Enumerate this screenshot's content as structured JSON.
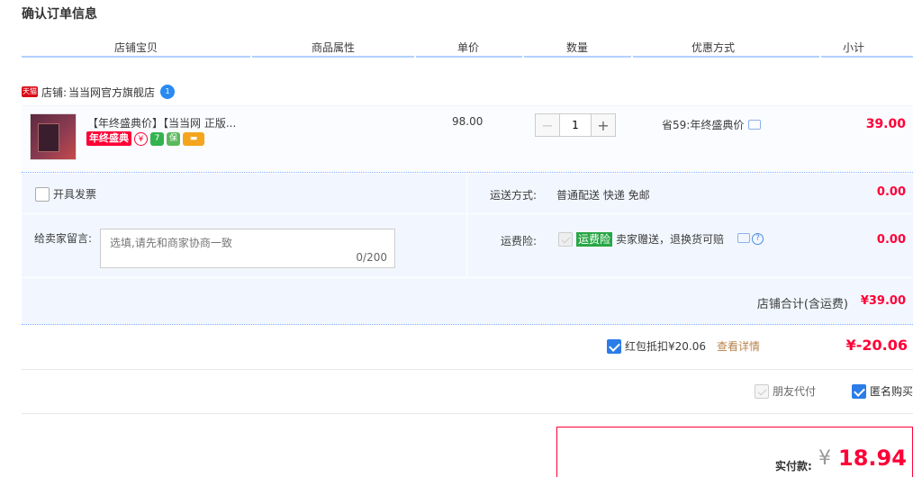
{
  "page_title": "确认订单信息",
  "columns": [
    "店铺宝贝",
    "商品属性",
    "单价",
    "数量",
    "优惠方式",
    "小计"
  ],
  "shop": {
    "badge": "天猫",
    "prefix": "店铺:",
    "name": "当当网官方旗舰店",
    "chat_badge": "1"
  },
  "item": {
    "title": "【年终盛典价】【当当网 正版...",
    "promo_tag": "年终盛典",
    "icons": [
      "yuan-icon",
      "seven-day-return-icon",
      "guarantee-icon",
      "card-icon"
    ],
    "price": "98.00",
    "quantity": "1",
    "discount": "省59:年终盛典价",
    "subtotal": "39.00"
  },
  "options": {
    "invoice_label": "开具发票",
    "shipping_label": "运送方式:",
    "shipping_value": "普通配送 快递 免邮",
    "shipping_fee": "0.00",
    "message_label": "给卖家留言:",
    "message_placeholder": "选填,请先和商家协商一致",
    "message_count": "0/200",
    "insurance_label": "运费险:",
    "insurance_badge": "运费险",
    "insurance_text": "卖家赠送，退换货可赔",
    "insurance_fee": "0.00",
    "shop_total_label": "店铺合计(含运费)",
    "shop_total_value": "¥39.00"
  },
  "redpacket": {
    "label": "红包抵扣¥20.06",
    "link": "查看详情",
    "amount": "¥-20.06",
    "checked": true
  },
  "extras": {
    "friend_pay": "朋友代付",
    "anonymous": "匿名购买"
  },
  "payment": {
    "label": "实付款:",
    "currency": "¥",
    "amount": "18.94"
  },
  "colors": {
    "accent_red": "#ff0036",
    "accent_blue": "#2b7ce8",
    "row_bg": "#f2f7ff"
  }
}
